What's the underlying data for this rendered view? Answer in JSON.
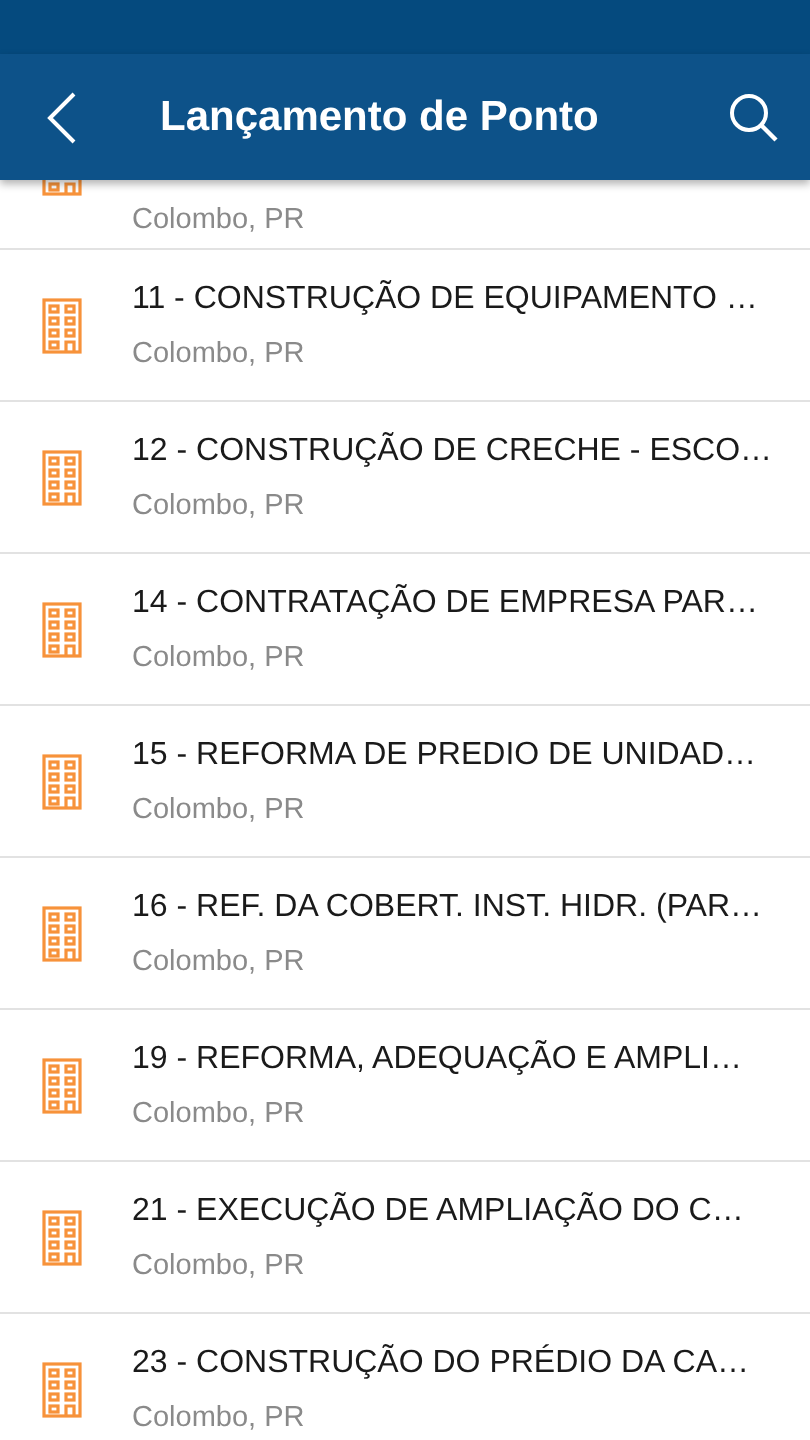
{
  "app_bar": {
    "title": "Lançamento de Ponto"
  },
  "items": [
    {
      "subtitle": "Colombo, PR"
    },
    {
      "title": "11 - CONSTRUÇÃO DE EQUIPAMENTO …",
      "subtitle": "Colombo, PR"
    },
    {
      "title": "12 - CONSTRUÇÃO DE CRECHE - ESCO…",
      "subtitle": "Colombo, PR"
    },
    {
      "title": "14 - CONTRATAÇÃO DE EMPRESA PAR…",
      "subtitle": "Colombo, PR"
    },
    {
      "title": "15 - REFORMA DE PREDIO DE UNIDAD…",
      "subtitle": "Colombo, PR"
    },
    {
      "title": "16 - REF. DA COBERT. INST. HIDR. (PAR…",
      "subtitle": "Colombo, PR"
    },
    {
      "title": "19 - REFORMA, ADEQUAÇÃO E AMPLI…",
      "subtitle": "Colombo, PR"
    },
    {
      "title": "21 - EXECUÇÃO DE AMPLIAÇÃO DO C…",
      "subtitle": "Colombo, PR"
    },
    {
      "title": "23 - CONSTRUÇÃO DO PRÉDIO DA CA…",
      "subtitle": "Colombo, PR"
    }
  ]
}
